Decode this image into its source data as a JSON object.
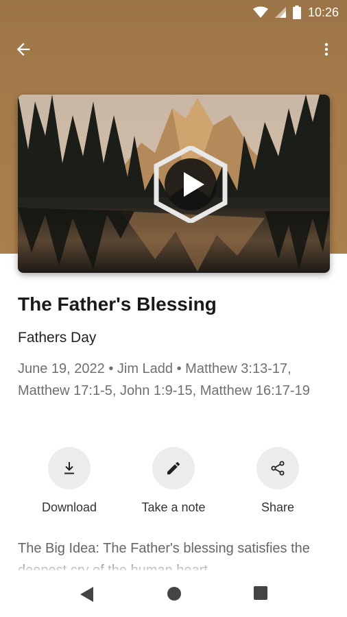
{
  "status_bar": {
    "time": "10:26"
  },
  "app_bar": {
    "back_icon": "arrow-back-icon",
    "menu_icon": "more-vert-icon"
  },
  "video": {
    "play_icon": "play-icon",
    "thumbnail": "mountain-lake-forest"
  },
  "sermon": {
    "title": "The Father's Blessing",
    "series": "Fathers Day",
    "meta": "June 19, 2022 • Jim Ladd • Matthew 3:13-17, Matthew 17:1-5, John 1:9-15, Matthew 16:17-19"
  },
  "actions": [
    {
      "label": "Download",
      "icon": "download-icon"
    },
    {
      "label": "Take a note",
      "icon": "pencil-icon"
    },
    {
      "label": "Share",
      "icon": "share-icon"
    }
  ],
  "description": "The Big Idea: The Father's blessing satisfies the deepest cry of the human heart.",
  "colors": {
    "header": "#a57b4a",
    "action_bg": "#ececec"
  }
}
